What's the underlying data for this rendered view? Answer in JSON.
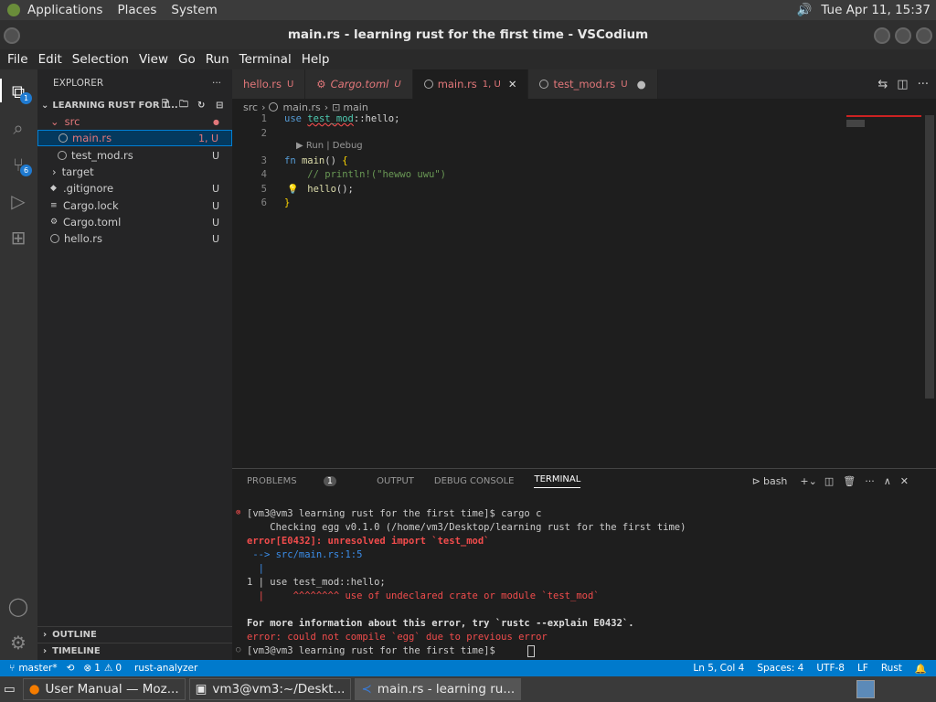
{
  "topbar": {
    "menus": [
      "Applications",
      "Places",
      "System"
    ],
    "clock": "Tue Apr 11, 15:37"
  },
  "window": {
    "title": "main.rs - learning rust for the first time - VSCodium"
  },
  "menubar": [
    "File",
    "Edit",
    "Selection",
    "View",
    "Go",
    "Run",
    "Terminal",
    "Help"
  ],
  "activity": {
    "explorer_badge": "1",
    "scm_badge": "6"
  },
  "sidebar": {
    "header": "EXPLORER",
    "section": "LEARNING RUST FOR T...",
    "items": [
      {
        "label": "src",
        "status": ""
      },
      {
        "label": "main.rs",
        "status": "1, U"
      },
      {
        "label": "test_mod.rs",
        "status": "U"
      },
      {
        "label": "target",
        "status": ""
      },
      {
        "label": ".gitignore",
        "status": "U"
      },
      {
        "label": "Cargo.lock",
        "status": "U"
      },
      {
        "label": "Cargo.toml",
        "status": "U"
      },
      {
        "label": "hello.rs",
        "status": "U"
      }
    ],
    "outline": "OUTLINE",
    "timeline": "TIMELINE"
  },
  "tabs": [
    {
      "label": "hello.rs",
      "status": "U"
    },
    {
      "label": "Cargo.toml",
      "status": "U"
    },
    {
      "label": "main.rs",
      "status": "1, U"
    },
    {
      "label": "test_mod.rs",
      "status": "U"
    }
  ],
  "breadcrumb": {
    "folder": "src",
    "file": "main.rs",
    "symbol": "main"
  },
  "code": {
    "lines": [
      {
        "n": "1",
        "text": "use test_mod::hello;"
      },
      {
        "n": "2",
        "text": ""
      },
      {
        "n": "3",
        "text": "fn main() {"
      },
      {
        "n": "4",
        "text": "    // println!(\"hewwo uwu\")"
      },
      {
        "n": "5",
        "text": "    hello();"
      },
      {
        "n": "6",
        "text": "}"
      }
    ],
    "codelens": "▶ Run | Debug"
  },
  "panel": {
    "tabs": [
      "PROBLEMS",
      "OUTPUT",
      "DEBUG CONSOLE",
      "TERMINAL"
    ],
    "problems_count": "1",
    "shell": "bash",
    "terminal": [
      "[vm3@vm3 learning rust for the first time]$ cargo c",
      "    Checking egg v0.1.0 (/home/vm3/Desktop/learning rust for the first time)",
      "error[E0432]: unresolved import `test_mod`",
      " --> src/main.rs:1:5",
      "  |",
      "1 | use test_mod::hello;",
      "  |     ^^^^^^^^ use of undeclared crate or module `test_mod`",
      "",
      "For more information about this error, try `rustc --explain E0432`.",
      "error: could not compile `egg` due to previous error",
      "[vm3@vm3 learning rust for the first time]$ "
    ]
  },
  "statusbar": {
    "branch": "master*",
    "errors": "1",
    "warnings": "0",
    "lsp": "rust-analyzer",
    "position": "Ln 5, Col 4",
    "spaces": "Spaces: 4",
    "encoding": "UTF-8",
    "eol": "LF",
    "language": "Rust"
  },
  "taskbar": [
    {
      "label": "User Manual — Moz..."
    },
    {
      "label": "vm3@vm3:~/Deskt..."
    },
    {
      "label": "main.rs - learning ru..."
    }
  ]
}
